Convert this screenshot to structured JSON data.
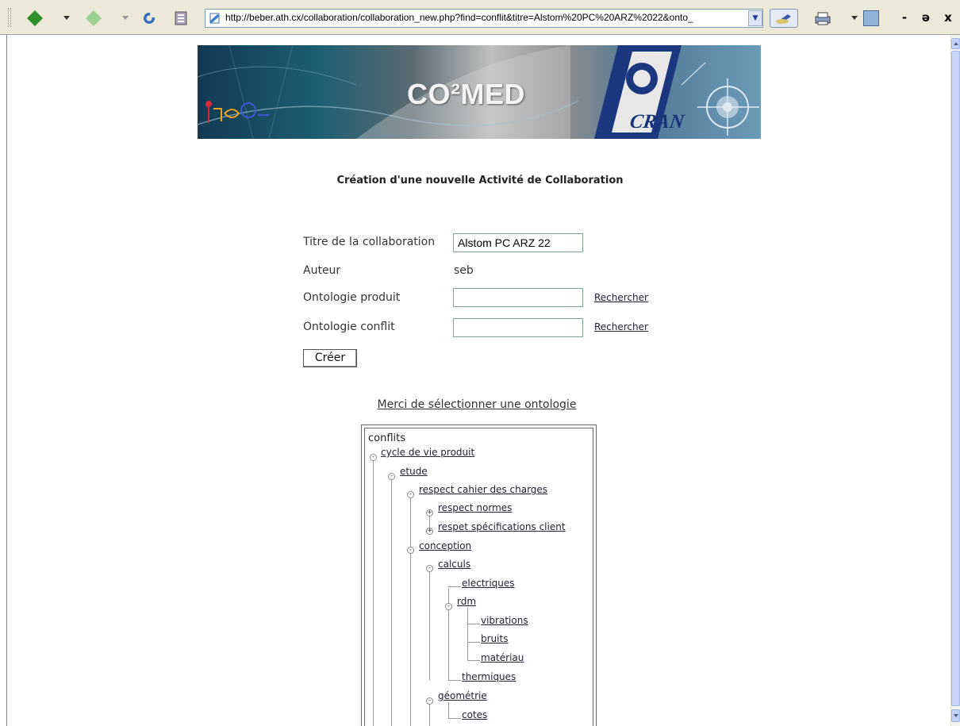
{
  "browser": {
    "address_url": "http://beber.ath.cx/collaboration/collaboration_new.php?find=conflit&titre=Alstom%20PC%20ARZ%2022&onto_",
    "window_controls": [
      "-",
      "ə",
      "x"
    ],
    "icons": [
      "back-icon",
      "forward-icon",
      "refresh-icon",
      "history-icon",
      "page-icon",
      "edit-icon",
      "print-icon",
      "messenger-icon"
    ]
  },
  "banner": {
    "title": "CO²MED",
    "logo_text": "CRAN"
  },
  "page": {
    "title": "Création d'une nouvelle Activité de Collaboration"
  },
  "form": {
    "titre_label": "Titre de la collaboration",
    "titre_value": "Alstom PC ARZ 22",
    "auteur_label": "Auteur",
    "auteur_value": "seb",
    "onto_produit_label": "Ontologie produit",
    "onto_produit_value": "",
    "onto_conflit_label": "Ontologie conflit",
    "onto_conflit_value": "",
    "rechercher_label": "Rechercher",
    "create_label": "Créer"
  },
  "select_message": "Merci de sélectionner une ontologie",
  "tree": {
    "root": "conflits",
    "nodes": {
      "cycle_de_vie_produit": "cycle de vie produit",
      "etude": "etude",
      "respect_cahier": "respect cahier des charges",
      "respect_normes": "respect normes",
      "respet_specifications": "respet spécifications client",
      "conception": "conception",
      "calculs": "calculs",
      "electriques": "electriques",
      "rdm": "rdm",
      "vibrations": "vibrations",
      "bruits": "bruits",
      "materiau": "matériau",
      "thermiques": "thermiques",
      "geometrie": "géométrie",
      "cotes": "cotes"
    },
    "collapse_symbol": "-",
    "expand_symbol": "+"
  }
}
